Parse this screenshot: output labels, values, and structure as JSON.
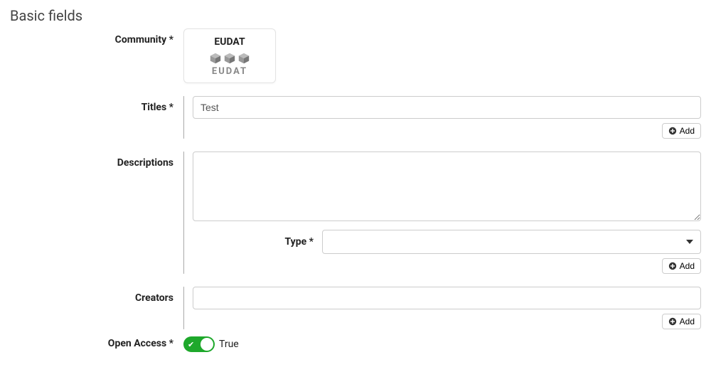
{
  "section_title": "Basic fields",
  "labels": {
    "community": "Community *",
    "titles": "Titles *",
    "descriptions": "Descriptions",
    "type": "Type *",
    "creators": "Creators",
    "open_access": "Open Access *"
  },
  "community": {
    "name": "EUDAT",
    "logo_text": "EUDAT"
  },
  "titles": {
    "value": "Test",
    "add_label": "Add"
  },
  "descriptions": {
    "value": "",
    "type_value": "",
    "add_label": "Add"
  },
  "creators": {
    "value": "",
    "add_label": "Add"
  },
  "open_access": {
    "state": true,
    "state_label": "True"
  },
  "colors": {
    "toggle_on": "#1ea82b"
  }
}
